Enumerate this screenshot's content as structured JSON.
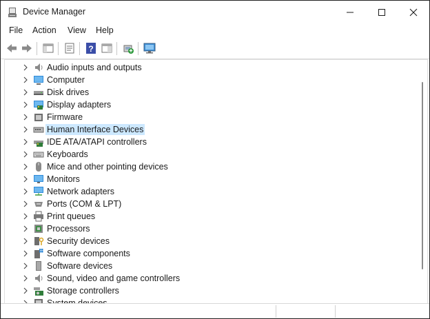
{
  "window": {
    "title": "Device Manager"
  },
  "menu": [
    "File",
    "Action",
    "View",
    "Help"
  ],
  "toolbar": {
    "buttons": [
      "back-arrow-icon",
      "forward-arrow-icon",
      "show-hide-tree-icon",
      "properties-icon",
      "help-icon",
      "action-view-icon",
      "update-driver-icon",
      "monitor-scan-icon"
    ]
  },
  "tree": {
    "selected": "Human Interface Devices",
    "items": [
      {
        "label": "Audio inputs and outputs",
        "icon": "speaker-icon"
      },
      {
        "label": "Computer",
        "icon": "computer-icon"
      },
      {
        "label": "Disk drives",
        "icon": "disk-drive-icon"
      },
      {
        "label": "Display adapters",
        "icon": "display-adapter-icon"
      },
      {
        "label": "Firmware",
        "icon": "firmware-icon"
      },
      {
        "label": "Human Interface Devices",
        "icon": "hid-icon"
      },
      {
        "label": "IDE ATA/ATAPI controllers",
        "icon": "ide-controller-icon"
      },
      {
        "label": "Keyboards",
        "icon": "keyboard-icon"
      },
      {
        "label": "Mice and other pointing devices",
        "icon": "mouse-icon"
      },
      {
        "label": "Monitors",
        "icon": "monitor-icon"
      },
      {
        "label": "Network adapters",
        "icon": "network-adapter-icon"
      },
      {
        "label": "Ports (COM & LPT)",
        "icon": "port-icon"
      },
      {
        "label": "Print queues",
        "icon": "printer-icon"
      },
      {
        "label": "Processors",
        "icon": "processor-icon"
      },
      {
        "label": "Security devices",
        "icon": "security-device-icon"
      },
      {
        "label": "Software components",
        "icon": "software-component-icon"
      },
      {
        "label": "Software devices",
        "icon": "software-device-icon"
      },
      {
        "label": "Sound, video and game controllers",
        "icon": "sound-icon"
      },
      {
        "label": "Storage controllers",
        "icon": "storage-controller-icon"
      },
      {
        "label": "System devices",
        "icon": "system-device-icon"
      }
    ]
  },
  "colors": {
    "selection": "#cce8ff",
    "accent_blue": "#1e88d8",
    "window_border": "#1f1f1f"
  }
}
